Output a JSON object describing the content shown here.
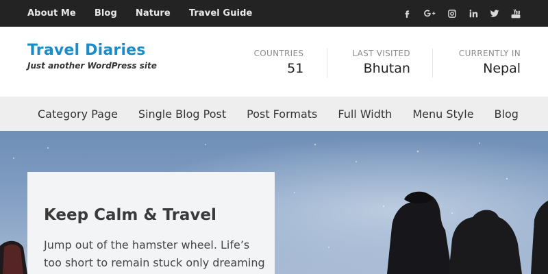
{
  "topbar": {
    "nav": [
      "About Me",
      "Blog",
      "Nature",
      "Travel Guide"
    ],
    "social_icons": [
      "facebook-icon",
      "google-plus-icon",
      "instagram-icon",
      "linkedin-icon",
      "twitter-icon",
      "youtube-icon"
    ],
    "social_glyphs": [
      "f",
      "G+",
      "",
      "in",
      "",
      ""
    ]
  },
  "header": {
    "title": "Travel Diaries",
    "tagline": "Just another WordPress site",
    "stats": [
      {
        "label": "COUNTRIES",
        "value": "51"
      },
      {
        "label": "LAST VISITED",
        "value": "Bhutan"
      },
      {
        "label": "CURRENTLY IN",
        "value": "Nepal"
      }
    ]
  },
  "menu": [
    "Category Page",
    "Single Blog Post",
    "Post Formats",
    "Full Width",
    "Menu Style",
    "Blog"
  ],
  "hero": {
    "title": "Keep Calm & Travel",
    "text": "Jump out of the hamster wheel. Life’s too short to remain stuck only dreaming"
  },
  "colors": {
    "topbar_bg": "#232323",
    "title_color": "#1a8cc6",
    "menu_bg": "#eeeeee"
  }
}
